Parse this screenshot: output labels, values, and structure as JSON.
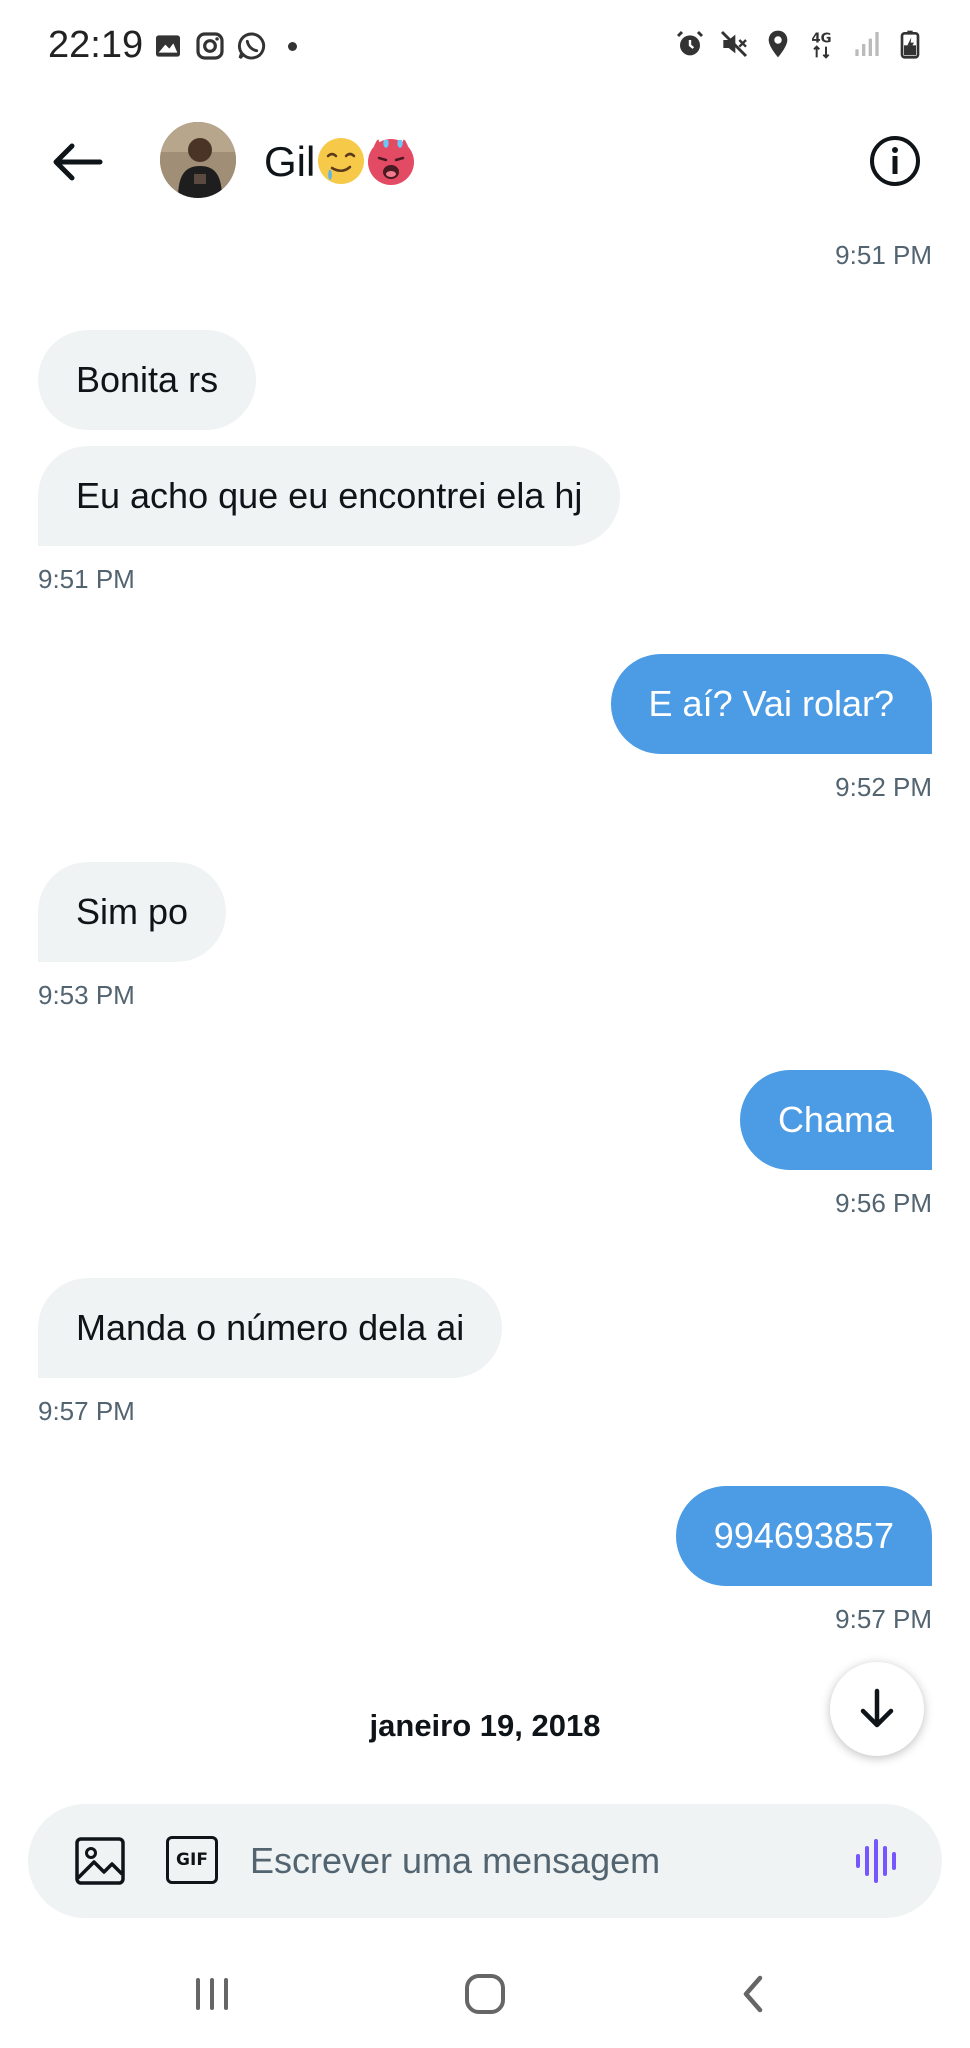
{
  "status_bar": {
    "time": "22:19",
    "left_icons": [
      "gallery-icon",
      "instagram-icon",
      "whatsapp-icon",
      "notification-dot"
    ],
    "right_icons": [
      "alarm-icon",
      "mute-icon",
      "location-icon",
      "network-4g-icon",
      "signal-icon",
      "battery-charging-icon"
    ],
    "network_label": "4G"
  },
  "header": {
    "contact_name": "Gil",
    "emojis": [
      "drooling-face",
      "hot-devil-face"
    ]
  },
  "messages": [
    {
      "direction": "out",
      "text": "",
      "time": "9:51 PM"
    },
    {
      "direction": "in",
      "text": "Bonita rs",
      "time": ""
    },
    {
      "direction": "in",
      "text": "Eu acho que eu encontrei ela hj",
      "time": "9:51 PM"
    },
    {
      "direction": "out",
      "text": "E aí? Vai rolar?",
      "time": "9:52 PM"
    },
    {
      "direction": "in",
      "text": "Sim po",
      "time": "9:53 PM"
    },
    {
      "direction": "out",
      "text": "Chama",
      "time": "9:56 PM"
    },
    {
      "direction": "in",
      "text": "Manda o número dela ai",
      "time": "9:57 PM"
    },
    {
      "direction": "out",
      "text": "994693857",
      "time": "9:57 PM"
    }
  ],
  "date_separator": "janeiro 19, 2018",
  "composer": {
    "placeholder": "Escrever uma mensagem",
    "gif_label": "GIF"
  },
  "colors": {
    "outgoing_bubble": "#4c9be5",
    "incoming_bubble": "#eff3f4",
    "voice_accent": "#7856ff"
  }
}
